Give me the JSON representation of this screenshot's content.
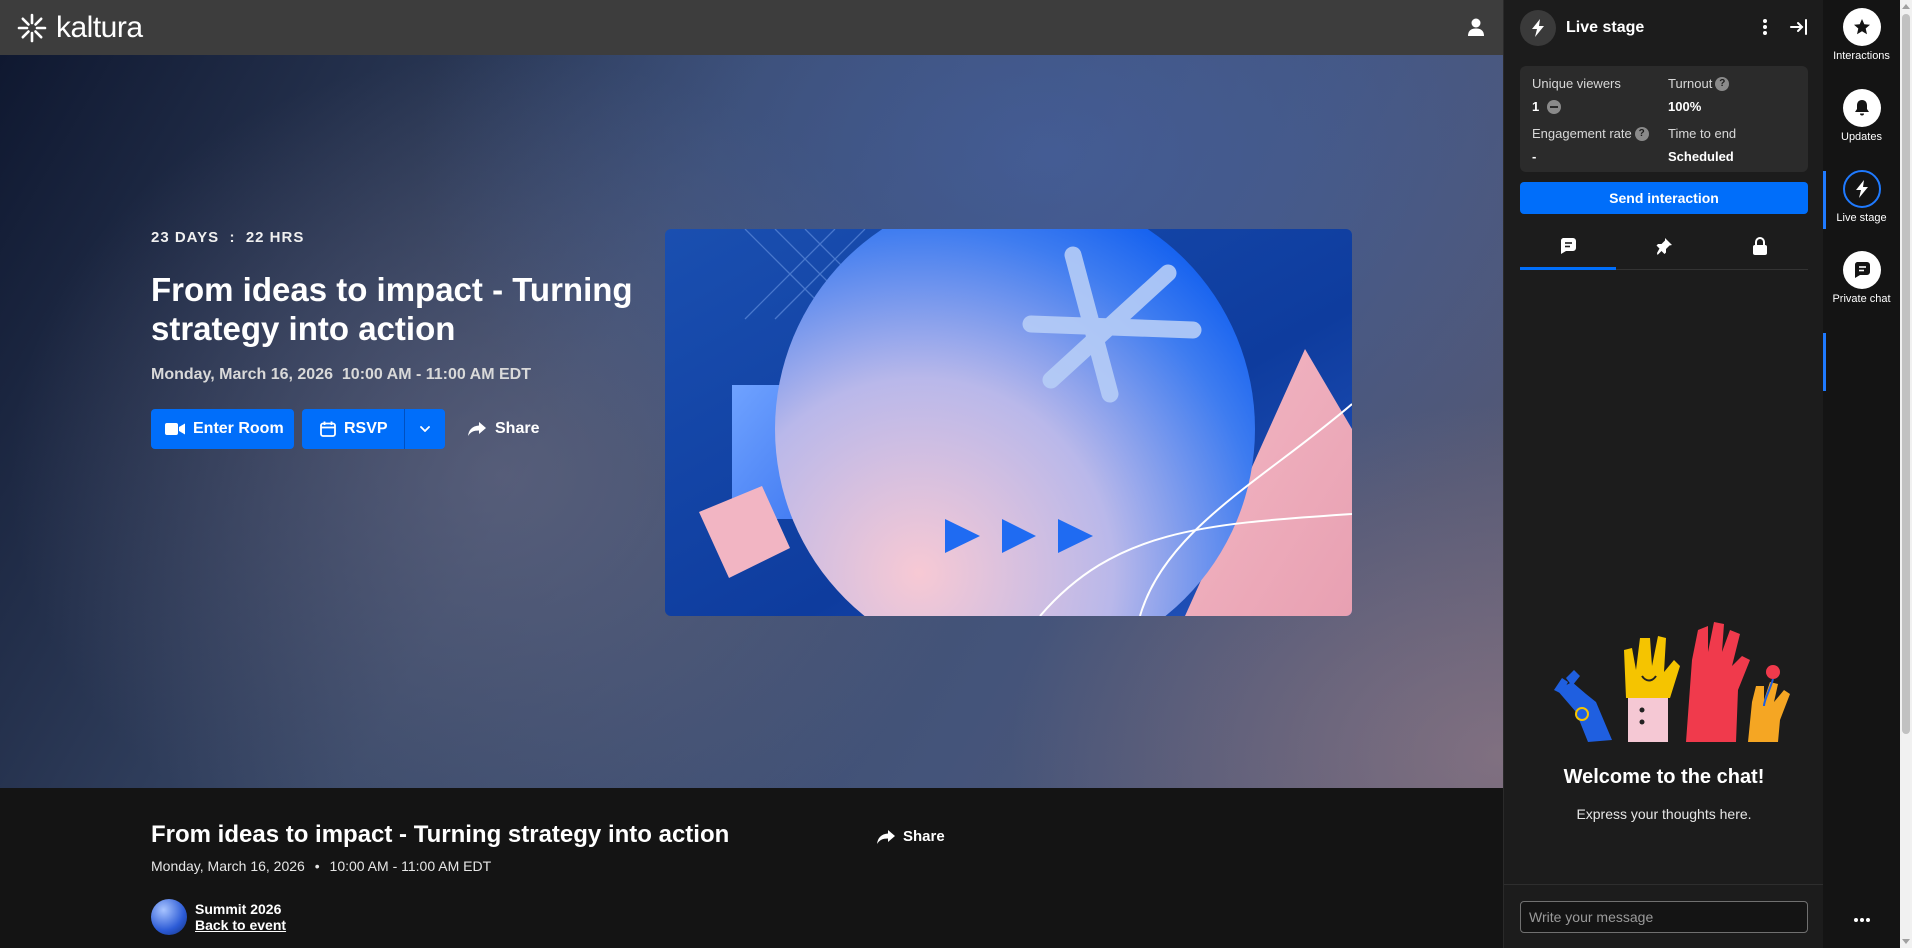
{
  "header": {
    "logo_text": "kaltura",
    "user_icon": "user-icon"
  },
  "hero": {
    "countdown": "23 DAYS  :  22 HRS",
    "title": "From ideas to impact - Turning strategy into action",
    "date": "Monday, March 16, 2026  10:00 AM - 11:00 AM EDT",
    "enter_room_label": "Enter Room",
    "rsvp_label": "RSVP",
    "share_label": "Share"
  },
  "event_info": {
    "title": "From ideas to impact - Turning strategy into action",
    "date": "Monday, March 16, 2026",
    "separator": "•",
    "time": "10:00 AM - 11:00 AM EDT",
    "share_label": "Share",
    "summit_name": "Summit 2026",
    "back_link": "Back to event"
  },
  "panel": {
    "title": "Live stage",
    "stats": {
      "unique_viewers_label": "Unique viewers",
      "unique_viewers_value": "1",
      "turnout_label": "Turnout",
      "turnout_value": "100%",
      "engagement_label": "Engagement rate",
      "engagement_value": "-",
      "time_to_end_label": "Time to end",
      "time_to_end_value": "Scheduled",
      "help_glyph": "?"
    },
    "send_interaction_label": "Send interaction",
    "tabs": [
      {
        "icon": "chat-icon",
        "active": true
      },
      {
        "icon": "pin-icon",
        "active": false
      },
      {
        "icon": "lock-icon",
        "active": false
      }
    ],
    "welcome_title": "Welcome to the chat!",
    "welcome_subtitle": "Express your thoughts here.",
    "message_placeholder": "Write your message"
  },
  "rail": {
    "items": [
      {
        "label": "Interactions",
        "icon": "star-icon"
      },
      {
        "label": "Updates",
        "icon": "bell-icon"
      },
      {
        "label": "Live stage",
        "icon": "bolt-icon",
        "active": true
      },
      {
        "label": "Private chat",
        "icon": "chat-icon"
      }
    ],
    "more_icon": "more-horizontal-icon"
  },
  "colors": {
    "accent": "#006efa",
    "panel_bg": "#1c1c1c",
    "header_bg": "#3d3d3d"
  }
}
